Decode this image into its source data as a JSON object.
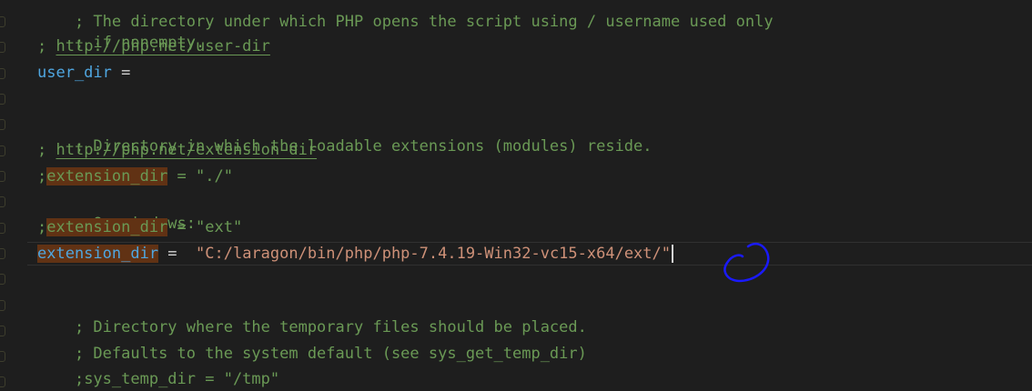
{
  "editor": {
    "line_top_partial": "; The directory under which PHP opens the script using / username used only",
    "line_if_nonempty": "; if nonempty.",
    "line_userdir_prefix": "; ",
    "line_userdir_url": "http://php.net/user-dir",
    "line_userdir_key": "user_dir",
    "line_userdir_op": " =",
    "line_extdir_comment": "; Directory in which the loadable extensions (modules) reside.",
    "line_extdir_url_prefix": "; ",
    "line_extdir_url": "http://php.net/extension-dir",
    "line_ext1_semicolon": ";",
    "line_ext1_key": "extension_dir",
    "line_ext1_rest": " = \"./\"",
    "line_onwin": "; On windows:",
    "line_ext2_semicolon": ";",
    "line_ext2_key": "extension_dir",
    "line_ext2_rest": " = \"ext\"",
    "line_active_key": "extension_dir",
    "line_active_op": " =  ",
    "line_active_value": "\"C:/laragon/bin/php/php-7.4.19-Win32-vc15-x64/ext/\"",
    "line_tempdir_comment": "; Directory where the temporary files should be placed.",
    "line_defaults_comment": "; Defaults to the system default (see sys_get_temp_dir)",
    "line_systemp": ";sys_temp_dir = \"/tmp\""
  },
  "colors": {
    "background": "#1e1e1e",
    "comment": "#6a9955",
    "key": "#4fa6e0",
    "string": "#ce9178",
    "highlight": "#613214",
    "annotation": "#1a1aff"
  }
}
